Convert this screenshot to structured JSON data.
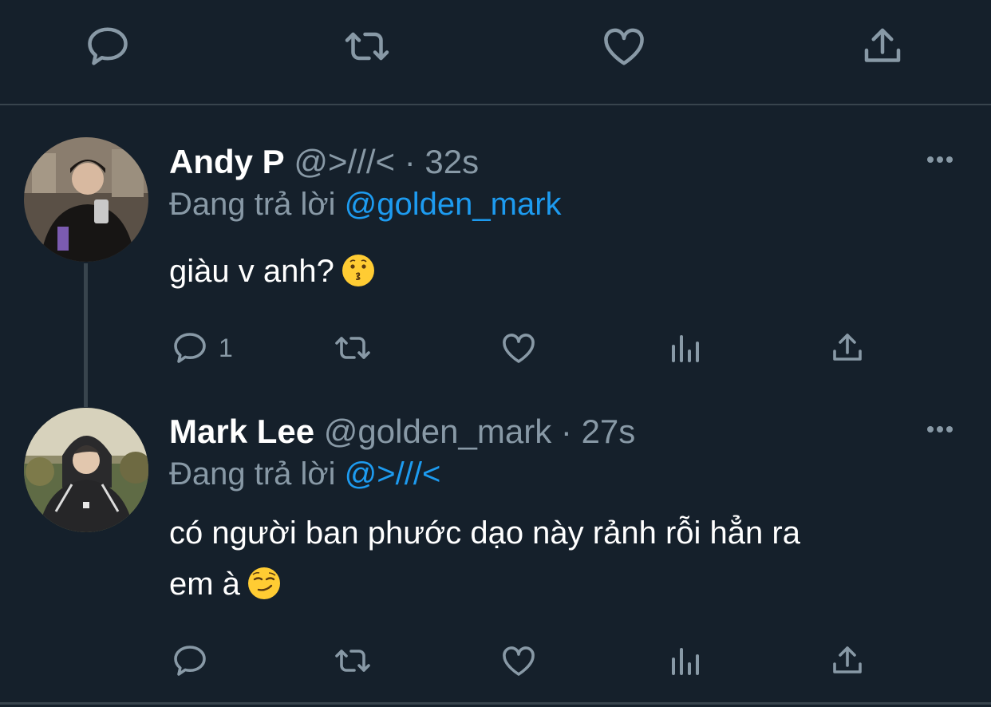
{
  "colors": {
    "background": "#15202b",
    "divider": "#38444d",
    "secondary_text": "#8899a6",
    "mention": "#1d9bf0"
  },
  "top_actions": {
    "icons": [
      "reply-icon",
      "retweet-icon",
      "like-icon",
      "share-icon"
    ]
  },
  "tweets": [
    {
      "name": "Andy P",
      "handle": "@>///<",
      "separator": "·",
      "time": "32s",
      "reply_prefix": "Đang trả lời",
      "reply_mention": "@golden_mark",
      "text": "giàu v anh?",
      "emoji": "kissing-face",
      "reply_count": "1",
      "actions": [
        "reply-icon",
        "retweet-icon",
        "like-icon",
        "analytics-icon",
        "share-icon"
      ]
    },
    {
      "name": "Mark Lee",
      "handle": "@golden_mark",
      "separator": "·",
      "time": "27s",
      "reply_prefix": "Đang trả lời",
      "reply_mention": "@>///<",
      "text_line1": "có người ban phước dạo này rảnh rỗi hẳn ra",
      "text_line2": "em à",
      "emoji": "smirking-face",
      "actions": [
        "reply-icon",
        "retweet-icon",
        "like-icon",
        "analytics-icon",
        "share-icon"
      ]
    }
  ]
}
